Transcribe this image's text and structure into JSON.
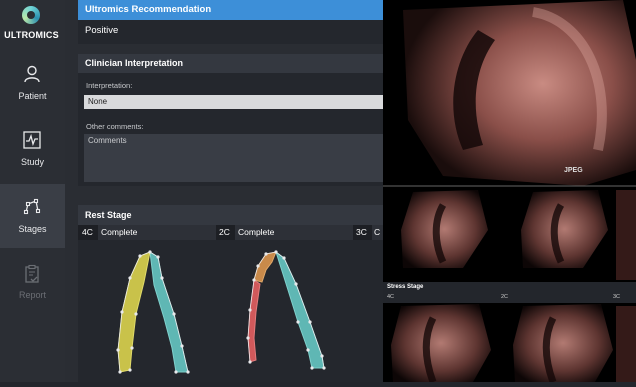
{
  "sidebar": {
    "logo_text": "ULTROMICS",
    "items": [
      {
        "label": "Patient",
        "icon": "person-icon",
        "active": false,
        "disabled": false
      },
      {
        "label": "Study",
        "icon": "heartbeat-chart-icon",
        "active": false,
        "disabled": false
      },
      {
        "label": "Stages",
        "icon": "stages-nodes-icon",
        "active": true,
        "disabled": false
      },
      {
        "label": "Report",
        "icon": "clipboard-check-icon",
        "active": false,
        "disabled": true
      }
    ]
  },
  "recommendation": {
    "title": "Ultromics Recommendation",
    "value": "Positive",
    "accent": "#3d8fd8"
  },
  "clinician": {
    "title": "Clinician Interpretation",
    "interpretation_label": "Interpretation:",
    "interpretation_value": "None",
    "comments_label": "Other comments:",
    "comments_placeholder": "Comments"
  },
  "rest_stage": {
    "title": "Rest Stage",
    "views": [
      {
        "code": "4C",
        "status": "Complete"
      },
      {
        "code": "2C",
        "status": "Complete"
      },
      {
        "code": "3C",
        "status": "C"
      }
    ],
    "segment_colors": {
      "yellow": "#c9c24a",
      "teal": "#5fb7b4",
      "red": "#d1595b",
      "orange": "#c98a4a"
    }
  },
  "ultrasound": {
    "watermark": "JPEG",
    "stress_stage": {
      "title": "Stress Stage",
      "views": [
        "4C",
        "2C",
        "3C"
      ]
    }
  }
}
